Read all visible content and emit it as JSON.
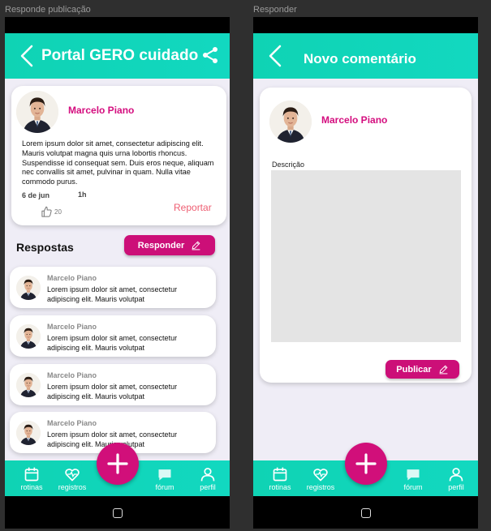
{
  "frames": {
    "left_label": "Responde publicação",
    "right_label": "Responder"
  },
  "colors": {
    "accent": "#12d8c0",
    "brand": "#d10f7a",
    "report": "#ee5e72",
    "background": "#efedf6"
  },
  "left": {
    "header": {
      "title": "Portal GERO cuidado"
    },
    "post": {
      "author": "Marcelo Piano",
      "text": "Lorem ipsum dolor sit amet, consectetur adipiscing elit. Mauris volutpat magna quis urna lobortis rhoncus. Suspendisse id consequat sem. Duis eros neque, aliquam nec convallis sit amet, pulvinar in quam. Nulla vitae commodo purus.",
      "date": "6 de jun",
      "time": "1h",
      "likes": "20",
      "report_label": "Reportar"
    },
    "replies_title": "Respostas",
    "reply_button": "Responder",
    "replies": [
      {
        "author": "Marcelo Piano",
        "text": "Lorem ipsum dolor sit amet, consectetur adipiscing elit. Mauris volutpat"
      },
      {
        "author": "Marcelo Piano",
        "text": "Lorem ipsum dolor sit amet, consectetur adipiscing elit. Mauris volutpat"
      },
      {
        "author": "Marcelo Piano",
        "text": "Lorem ipsum dolor sit amet, consectetur adipiscing elit. Mauris volutpat"
      },
      {
        "author": "Marcelo Piano",
        "text": "Lorem ipsum dolor sit amet, consectetur adipiscing elit. Mauris volutpat"
      }
    ]
  },
  "right": {
    "header": {
      "title": "Novo comentário"
    },
    "author": "Marcelo Piano",
    "field_label": "Descrição",
    "description_value": "",
    "publish_button": "Publicar"
  },
  "nav": {
    "items": [
      {
        "label": "rotinas",
        "icon": "calendar-icon"
      },
      {
        "label": "registros",
        "icon": "heart-pulse-icon"
      },
      {
        "label": "fórum",
        "icon": "chat-icon"
      },
      {
        "label": "perfil",
        "icon": "user-icon"
      }
    ],
    "fab_icon": "plus-icon"
  }
}
